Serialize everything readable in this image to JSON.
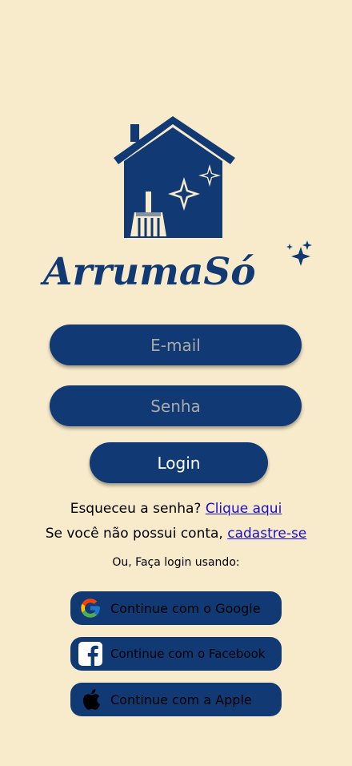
{
  "brand": {
    "name": "ArrumaSó",
    "primary_color": "#113a75",
    "background_color": "#f8ebcb"
  },
  "form": {
    "email_placeholder": "E-mail",
    "password_placeholder": "Senha",
    "login_label": "Login"
  },
  "links": {
    "forgot_text": "Esqueceu a senha? ",
    "forgot_link": "Clique aqui",
    "signup_text": "Se você não possui conta, ",
    "signup_link": "cadastre-se",
    "alt_login_label": "Ou, Faça login usando:"
  },
  "social": {
    "google_label": "Continue com o Google",
    "facebook_label": "Continue com o Facebook",
    "apple_label": "Continue com a Apple"
  },
  "icons": [
    "house-broom-logo-icon",
    "sparkles-icon",
    "google-icon",
    "facebook-icon",
    "apple-icon"
  ]
}
